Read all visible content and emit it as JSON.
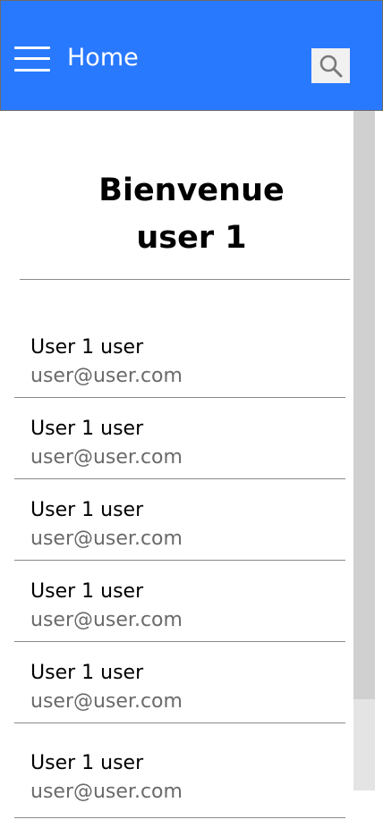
{
  "appbar": {
    "title": "Home",
    "menu_icon": "hamburger-menu-icon",
    "search_icon": "search-icon",
    "background_color": "#2979ff"
  },
  "welcome": {
    "line1": "Bienvenue",
    "line2": "user 1"
  },
  "users": [
    {
      "name": "User 1 user",
      "email": "user@user.com"
    },
    {
      "name": "User 1 user",
      "email": "user@user.com"
    },
    {
      "name": "User 1 user",
      "email": "user@user.com"
    },
    {
      "name": "User 1 user",
      "email": "user@user.com"
    },
    {
      "name": "User 1 user",
      "email": "user@user.com"
    },
    {
      "name": "User 1 user",
      "email": "user@user.com"
    }
  ]
}
